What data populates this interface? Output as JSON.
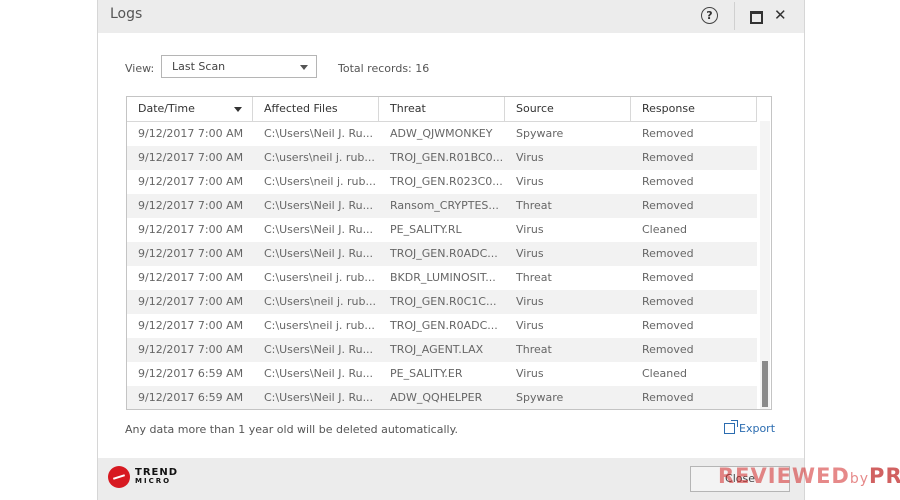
{
  "window": {
    "title": "Logs",
    "help_label": "?"
  },
  "filters": {
    "view_label": "View:",
    "view_value": "Last Scan",
    "total_label": "Total records: 16"
  },
  "table": {
    "columns": [
      "Date/Time",
      "Affected Files",
      "Threat",
      "Source",
      "Response"
    ],
    "sort_column": "Date/Time",
    "rows": [
      [
        "9/12/2017 7:00 AM",
        "C:\\Users\\Neil J. Ru...",
        "ADW_QJWMONKEY",
        "Spyware",
        "Removed"
      ],
      [
        "9/12/2017 7:00 AM",
        "C:\\users\\neil j. rub...",
        "TROJ_GEN.R01BC0...",
        "Virus",
        "Removed"
      ],
      [
        "9/12/2017 7:00 AM",
        "C:\\Users\\neil j. rub...",
        "TROJ_GEN.R023C0...",
        "Virus",
        "Removed"
      ],
      [
        "9/12/2017 7:00 AM",
        "C:\\Users\\Neil J. Ru...",
        "Ransom_CRYPTES...",
        "Threat",
        "Removed"
      ],
      [
        "9/12/2017 7:00 AM",
        "C:\\Users\\Neil J. Ru...",
        "PE_SALITY.RL",
        "Virus",
        "Cleaned"
      ],
      [
        "9/12/2017 7:00 AM",
        "C:\\Users\\Neil J. Ru...",
        "TROJ_GEN.R0ADC...",
        "Virus",
        "Removed"
      ],
      [
        "9/12/2017 7:00 AM",
        "C:\\users\\neil j. rub...",
        "BKDR_LUMINOSIT...",
        "Threat",
        "Removed"
      ],
      [
        "9/12/2017 7:00 AM",
        "C:\\Users\\neil j. rub...",
        "TROJ_GEN.R0C1C...",
        "Virus",
        "Removed"
      ],
      [
        "9/12/2017 7:00 AM",
        "C:\\users\\neil j. rub...",
        "TROJ_GEN.R0ADC...",
        "Virus",
        "Removed"
      ],
      [
        "9/12/2017 7:00 AM",
        "C:\\Users\\Neil J. Ru...",
        "TROJ_AGENT.LAX",
        "Threat",
        "Removed"
      ],
      [
        "9/12/2017 6:59 AM",
        "C:\\Users\\Neil J. Ru...",
        "PE_SALITY.ER",
        "Virus",
        "Cleaned"
      ],
      [
        "9/12/2017 6:59 AM",
        "C:\\Users\\Neil J. Ru...",
        "ADW_QQHELPER",
        "Spyware",
        "Removed"
      ]
    ]
  },
  "footer": {
    "notice": "Any data more than 1 year old will be deleted automatically.",
    "export_label": "Export",
    "close_label": "Close",
    "logo_line1": "TREND",
    "logo_line2": "MICRO"
  },
  "watermark": {
    "part1": "REVIEWED",
    "part2": "by",
    "part3": "PRO"
  },
  "colors": {
    "link": "#2b6cb0",
    "brand_red": "#d71921",
    "row_alt": "#f2f2f2"
  }
}
